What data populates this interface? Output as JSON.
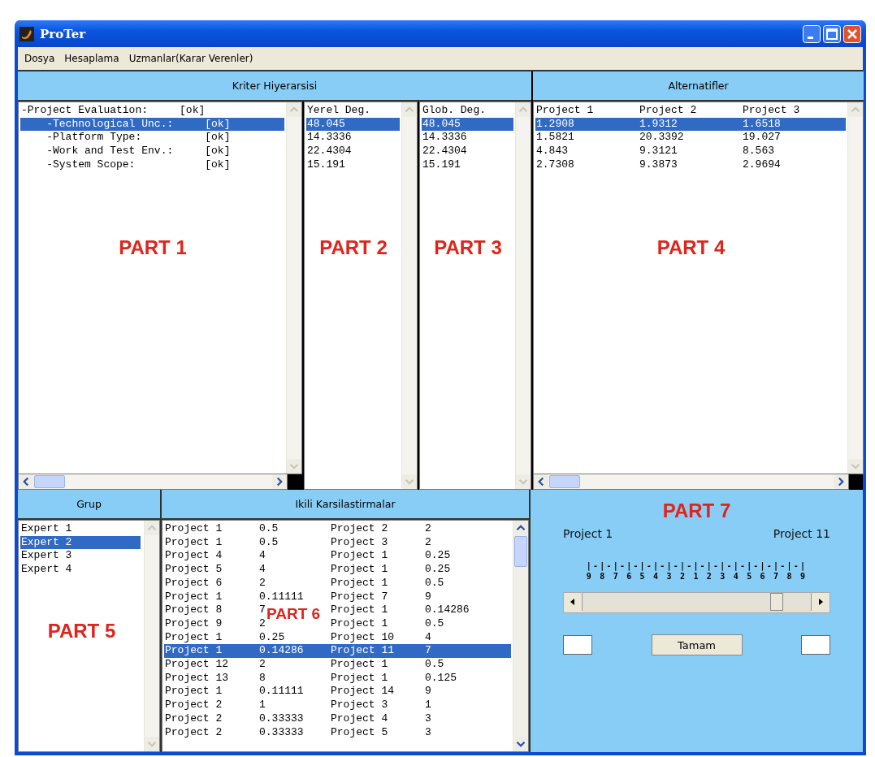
{
  "window": {
    "title": "ProTer"
  },
  "menu": [
    "Dosya",
    "Hesaplama",
    "Uzmanlar(Karar Verenler)"
  ],
  "criteria": {
    "header": "Kriter Hiyerarsisi",
    "annotation": "PART 1",
    "rows": [
      {
        "label": "-Project Evaluation:",
        "status": "[ok]",
        "selected": false,
        "children": [
          {
            "label": "-Technological Unc.:",
            "status": "[ok]",
            "selected": true
          },
          {
            "label": "-Platform Type:",
            "status": "[ok]",
            "selected": false
          },
          {
            "label": "-Work and Test Env.:",
            "status": "[ok]",
            "selected": false
          },
          {
            "label": "-System Scope:",
            "status": "[ok]",
            "selected": false
          }
        ]
      }
    ]
  },
  "local_weights": {
    "annotation": "PART 2",
    "rows": [
      {
        "text": "Yerel Deg.",
        "selected": false
      },
      {
        "text": "48.045",
        "selected": true
      },
      {
        "text": "14.3336",
        "selected": false
      },
      {
        "text": "22.4304",
        "selected": false
      },
      {
        "text": "15.191",
        "selected": false
      }
    ]
  },
  "global_weights": {
    "annotation": "PART 3",
    "rows": [
      {
        "text": "Glob. Deg.",
        "selected": false
      },
      {
        "text": "48.045",
        "selected": true
      },
      {
        "text": "14.3336",
        "selected": false
      },
      {
        "text": "22.4304",
        "selected": false
      },
      {
        "text": "15.191",
        "selected": false
      }
    ]
  },
  "alternatives": {
    "header": "Alternatifler",
    "annotation": "PART 4",
    "rows": [
      {
        "cells": [
          "Project 1",
          "Project 2",
          "Project 3"
        ],
        "selected": false
      },
      {
        "cells": [
          "1.2908",
          "1.9312",
          "1.6518"
        ],
        "selected": true
      },
      {
        "cells": [
          "1.5821",
          "20.3392",
          "19.027"
        ],
        "selected": false
      },
      {
        "cells": [
          "4.843",
          "9.3121",
          "8.563"
        ],
        "selected": false
      },
      {
        "cells": [
          "2.7308",
          "9.3873",
          "2.9694"
        ],
        "selected": false
      }
    ]
  },
  "group": {
    "header": "Grup",
    "annotation": "PART 5",
    "items": [
      {
        "label": "Expert 1",
        "selected": false
      },
      {
        "label": "Expert 2",
        "selected": true
      },
      {
        "label": "Expert 3",
        "selected": false
      },
      {
        "label": "Expert 4",
        "selected": false
      }
    ]
  },
  "comparisons": {
    "header": "Ikili Karsilastirmalar",
    "annotation": "PART 6",
    "rows": [
      {
        "cells": [
          "Project 1",
          "0.5",
          "Project 2",
          "2"
        ],
        "selected": false
      },
      {
        "cells": [
          "Project 1",
          "0.5",
          "Project 3",
          "2"
        ],
        "selected": false
      },
      {
        "cells": [
          "Project 4",
          "4",
          "Project 1",
          "0.25"
        ],
        "selected": false
      },
      {
        "cells": [
          "Project 5",
          "4",
          "Project 1",
          "0.25"
        ],
        "selected": false
      },
      {
        "cells": [
          "Project 6",
          "2",
          "Project 1",
          "0.5"
        ],
        "selected": false
      },
      {
        "cells": [
          "Project 1",
          "0.11111",
          "Project 7",
          "9"
        ],
        "selected": false
      },
      {
        "cells": [
          "Project 8",
          "7",
          "Project 1",
          "0.14286"
        ],
        "selected": false
      },
      {
        "cells": [
          "Project 9",
          "2",
          "Project 1",
          "0.5"
        ],
        "selected": false
      },
      {
        "cells": [
          "Project 1",
          "0.25",
          "Project 10",
          "4"
        ],
        "selected": false
      },
      {
        "cells": [
          "Project 1",
          "0.14286",
          "Project 11",
          "7"
        ],
        "selected": true
      },
      {
        "cells": [
          "Project 12",
          "2",
          "Project 1",
          "0.5"
        ],
        "selected": false
      },
      {
        "cells": [
          "Project 13",
          "8",
          "Project 1",
          "0.125"
        ],
        "selected": false
      },
      {
        "cells": [
          "Project 1",
          "0.11111",
          "Project 14",
          "9"
        ],
        "selected": false
      },
      {
        "cells": [
          "Project 2",
          "1",
          "Project 3",
          "1"
        ],
        "selected": false
      },
      {
        "cells": [
          "Project 2",
          "0.33333",
          "Project 4",
          "3"
        ],
        "selected": false
      },
      {
        "cells": [
          "Project 2",
          "0.33333",
          "Project 5",
          "3"
        ],
        "selected": false
      }
    ]
  },
  "comparison_panel": {
    "annotation": "PART 7",
    "left_label": "Project 1",
    "right_label": "Project 11",
    "scale_ticks": "|-|-|-|-|-|-|-|-|-|-|-|-|-|-|-|-|",
    "scale_numbers": "9 8 7 6 5 4 3 2 1 2 3 4 5 6 7 8 9",
    "slider": {
      "level": 0.87
    },
    "ok_button": "Tamam"
  }
}
